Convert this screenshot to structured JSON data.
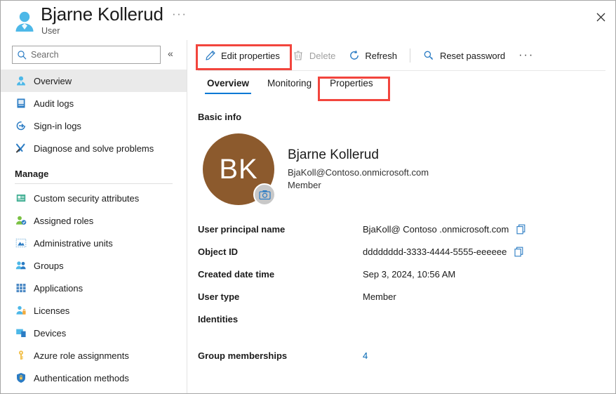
{
  "header": {
    "title": "Bjarne Kollerud",
    "subtitle": "User",
    "ellipsis": "···",
    "close_label": "Close"
  },
  "sidebar": {
    "search": {
      "placeholder": "Search",
      "value": ""
    },
    "collapse_label": "«",
    "items": [
      {
        "label": "Overview",
        "icon": "user-icon",
        "active": true
      },
      {
        "label": "Audit logs",
        "icon": "audit-log-icon",
        "active": false
      },
      {
        "label": "Sign-in logs",
        "icon": "sign-in-icon",
        "active": false
      },
      {
        "label": "Diagnose and solve problems",
        "icon": "wrench-icon",
        "active": false
      }
    ],
    "manage_section": "Manage",
    "manage_items": [
      {
        "label": "Custom security attributes",
        "icon": "attributes-icon"
      },
      {
        "label": "Assigned roles",
        "icon": "assigned-roles-icon"
      },
      {
        "label": "Administrative units",
        "icon": "administrative-units-icon"
      },
      {
        "label": "Groups",
        "icon": "groups-icon"
      },
      {
        "label": "Applications",
        "icon": "applications-icon"
      },
      {
        "label": "Licenses",
        "icon": "licenses-icon"
      },
      {
        "label": "Devices",
        "icon": "devices-icon"
      },
      {
        "label": "Azure role assignments",
        "icon": "key-icon"
      },
      {
        "label": "Authentication methods",
        "icon": "shield-icon"
      }
    ]
  },
  "toolbar": {
    "edit_properties": "Edit properties",
    "delete": "Delete",
    "refresh": "Refresh",
    "reset_password": "Reset password",
    "more": "···"
  },
  "tabs": [
    {
      "label": "Overview",
      "active": true
    },
    {
      "label": "Monitoring",
      "active": false
    },
    {
      "label": "Properties",
      "active": false
    }
  ],
  "basic_info": {
    "section_title": "Basic info",
    "avatar_initials": "BK",
    "name": "Bjarne Kollerud",
    "email": "BjaKoll@Contoso.onmicrosoft.com",
    "user_type": "Member"
  },
  "fields": [
    {
      "key": "User principal name",
      "value": "BjaKoll@ Contoso .onmicrosoft.com",
      "copy": true
    },
    {
      "key": "Object ID",
      "value": "dddddddd-3333-4444-5555-eeeeee",
      "copy": true
    },
    {
      "key": "Created date time",
      "value": "Sep 3, 2024, 10:56 AM",
      "copy": false
    },
    {
      "key": "User type",
      "value": "Member",
      "copy": false
    },
    {
      "key": "Identities",
      "value": "",
      "copy": false
    }
  ],
  "group_memberships": {
    "key": "Group memberships",
    "value": "4"
  },
  "colors": {
    "accent": "#0078d4",
    "highlight": "#f2453d",
    "avatar": "#8c5a2d",
    "link": "#0066b4",
    "active_row": "#eaeaea"
  }
}
